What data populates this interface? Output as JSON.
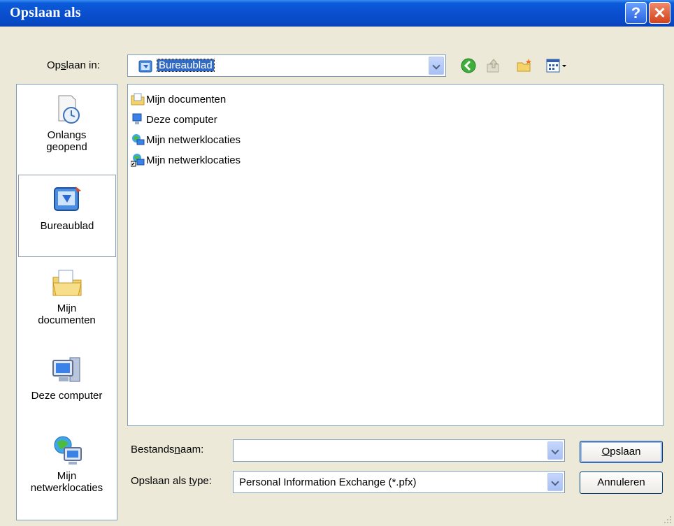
{
  "window": {
    "title": "Opslaan als"
  },
  "titlebar": {
    "help_label": "?",
    "close_label": "✕"
  },
  "toolbar": {
    "save_in_label_pre": "Op",
    "save_in_label_u": "s",
    "save_in_label_post": "laan in:",
    "location_value": "Bureaublad"
  },
  "places": [
    {
      "label_1": "Onlangs",
      "label_2": "geopend"
    },
    {
      "label_1": "Bureaublad",
      "label_2": ""
    },
    {
      "label_1": "Mijn",
      "label_2": "documenten"
    },
    {
      "label_1": "Deze computer",
      "label_2": ""
    },
    {
      "label_1": "Mijn",
      "label_2": "netwerklocaties"
    }
  ],
  "files": [
    {
      "name": "Mijn documenten",
      "icon": "folder-icon"
    },
    {
      "name": "Deze computer",
      "icon": "computer-icon"
    },
    {
      "name": "Mijn netwerklocaties",
      "icon": "network-icon"
    },
    {
      "name": "Mijn netwerklocaties",
      "icon": "network-shortcut-icon"
    }
  ],
  "filename": {
    "label_pre": "Bestands",
    "label_u": "n",
    "label_post": "aam:",
    "value": ""
  },
  "filetype": {
    "label_pre": "Opslaan als ",
    "label_u": "t",
    "label_post": "ype:",
    "value": "Personal Information Exchange (*.pfx)"
  },
  "buttons": {
    "save_u": "O",
    "save_rest": "pslaan",
    "cancel": "Annuleren"
  },
  "colors": {
    "titlebar": "#0a4fd0",
    "dialog_bg": "#ece9d8",
    "selection": "#316ac5"
  }
}
